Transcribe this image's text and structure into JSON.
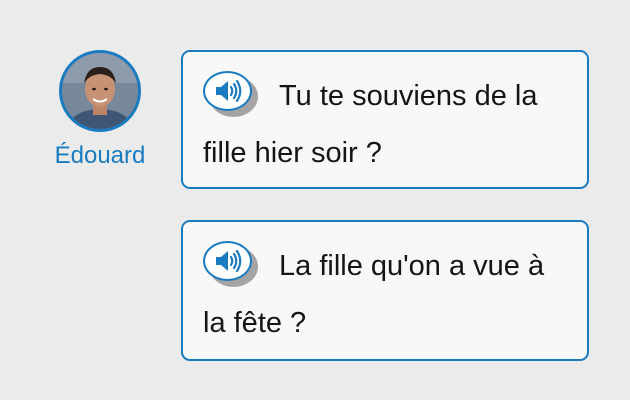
{
  "speaker": {
    "name": "Édouard",
    "avatar_icon": "person-photo",
    "accent_color": "#1a7bc1"
  },
  "messages": [
    {
      "text": "Tu te souviens de la fille hier soir ?",
      "audio_icon": "speaker-volume-icon"
    },
    {
      "text": "La fille qu'on a vue à la fête ?",
      "audio_icon": "speaker-volume-icon"
    }
  ]
}
